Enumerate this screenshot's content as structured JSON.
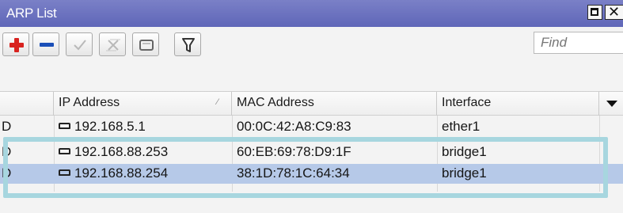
{
  "window": {
    "title": "ARP List"
  },
  "toolbar": {
    "add": "add-icon",
    "remove": "remove-icon",
    "enable": "check-icon",
    "disable": "cross-icon",
    "comment": "comment-icon",
    "filter": "filter-icon",
    "find_placeholder": "Find"
  },
  "table": {
    "columns": [
      "",
      "IP Address",
      "MAC Address",
      "Interface"
    ],
    "rows": [
      {
        "flag": "D",
        "ip": "192.168.5.1",
        "mac": "00:0C:42:A8:C9:83",
        "interface": "ether1"
      },
      {
        "flag": "D",
        "ip": "192.168.88.253",
        "mac": "60:EB:69:78:D9:1F",
        "interface": "bridge1"
      },
      {
        "flag": "D",
        "ip": "192.168.88.254",
        "mac": "38:1D:78:1C:64:34",
        "interface": "bridge1"
      }
    ],
    "selected_row": 2
  },
  "colors": {
    "titlebar": "#6a70bf",
    "selection": "#b6c9e8",
    "highlight": "#a7d6df",
    "add": "#d8231f",
    "remove": "#1b4fb8"
  }
}
